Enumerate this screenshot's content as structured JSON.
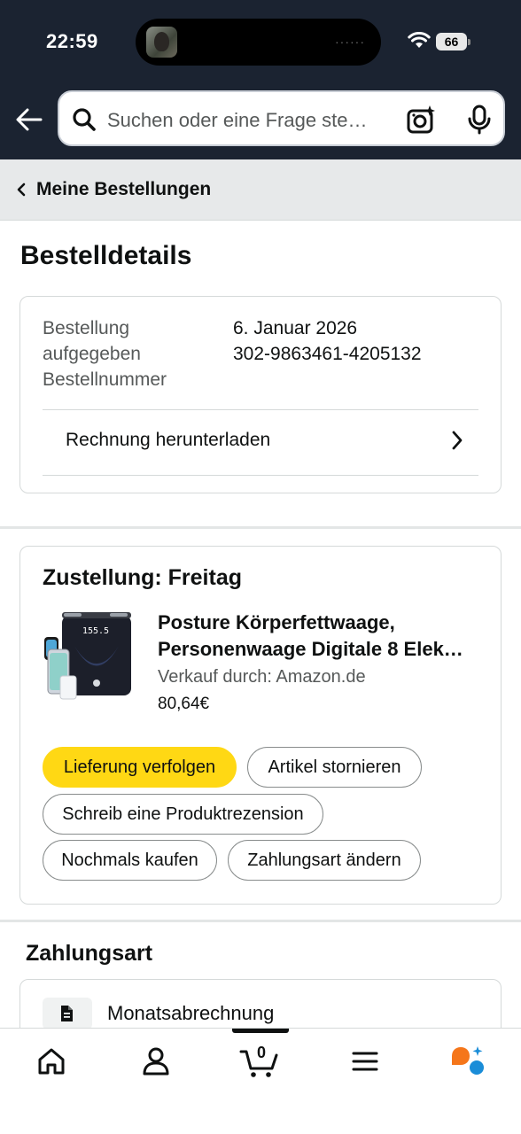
{
  "status_bar": {
    "time": "22:59",
    "island_dots": "······",
    "battery": "66"
  },
  "search": {
    "placeholder": "Suchen oder eine Frage ste…"
  },
  "icons": {
    "back": "back-arrow-icon",
    "search": "search-icon",
    "camera": "camera-sparkle-icon",
    "mic": "microphone-icon",
    "chevron_left": "chevron-left-icon",
    "chevron_right": "chevron-right-icon",
    "document": "document-icon",
    "home": "home-icon",
    "account": "person-icon",
    "cart": "cart-icon",
    "menu": "hamburger-menu-icon",
    "rufus": "rufus-ai-icon"
  },
  "breadcrumb": {
    "label": "Meine Bestellungen"
  },
  "page": {
    "title": "Bestelldetails"
  },
  "order": {
    "placed_label_line1": "Bestellung",
    "placed_label_line2": "aufgegeben",
    "number_label": "Bestellnummer",
    "placed_value": "6. Januar 2026",
    "number_value": "302-9863461-4205132",
    "invoice_link": "Rechnung herunterladen"
  },
  "delivery": {
    "title": "Zustellung: Freitag",
    "product_title_line1": "Posture Körperfettwaage,",
    "product_title_line2": "Personenwaage Digitale 8 Elek…",
    "seller": "Verkauf durch: Amazon.de",
    "price": "80,64€",
    "scale_display": "155.5",
    "actions": {
      "track": "Lieferung verfolgen",
      "cancel": "Artikel stornieren",
      "review": "Schreib eine Produktrezension",
      "buy_again": "Nochmals kaufen",
      "change_payment": "Zahlungsart ändern"
    }
  },
  "payment": {
    "title": "Zahlungsart",
    "method": "Monatsabrechnung"
  },
  "bottom_nav": {
    "cart_count": "0"
  },
  "colors": {
    "header_bg": "#1b2331",
    "primary_button": "#ffd814",
    "breadcrumb_bg": "#e7e9ea",
    "rufus_orange": "#f5761a",
    "rufus_blue": "#1a8dd8"
  }
}
